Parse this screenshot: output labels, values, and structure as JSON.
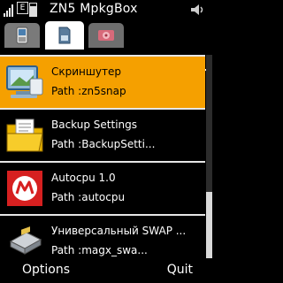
{
  "status_bar": {
    "network_badge": "E",
    "app_title": "ZN5 MpkgBox"
  },
  "tabs": [
    {
      "name": "phone-tab",
      "icon": "phone-icon"
    },
    {
      "name": "memory-card-tab",
      "icon": "memory-card-icon",
      "selected": true
    },
    {
      "name": "disc-tab",
      "icon": "disc-icon"
    }
  ],
  "list": {
    "items": [
      {
        "name": "Скриншутер",
        "path": "Path :zn5snap",
        "icon": "monitor-icon",
        "selected": true
      },
      {
        "name": "Backup Settings",
        "path": "Path :BackupSetti...",
        "icon": "folder-icon",
        "selected": false
      },
      {
        "name": "Autocpu 1.0",
        "path": "Path :autocpu",
        "icon": "motorola-logo-icon",
        "selected": false
      },
      {
        "name": "Универсальный SWAP ...",
        "path": "Path :magx_swa...",
        "icon": "chip-icon",
        "selected": false
      }
    ]
  },
  "softkeys": {
    "left": "Options",
    "right": "Quit"
  },
  "colors": {
    "selection": "#f5a000",
    "background": "#000000"
  }
}
